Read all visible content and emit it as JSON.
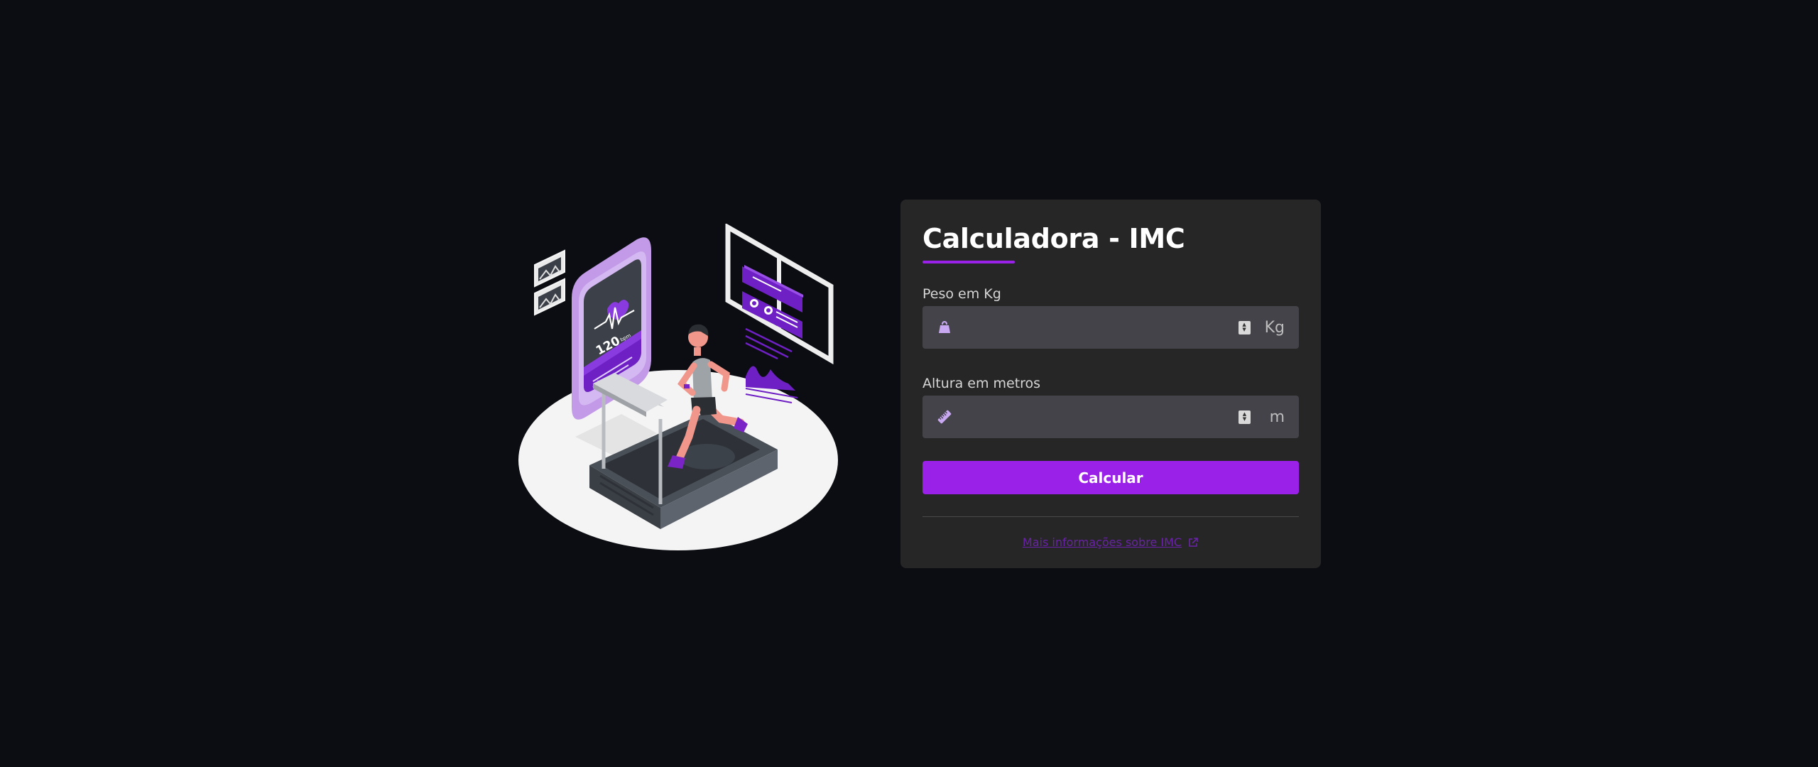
{
  "card": {
    "title": "Calculadora - IMC",
    "weight": {
      "label": "Peso em Kg",
      "value": "",
      "unit": "Kg",
      "icon": "weight-icon"
    },
    "height": {
      "label": "Altura em metros",
      "value": "",
      "unit": "m",
      "icon": "ruler-icon"
    },
    "button_label": "Calcular",
    "more_link": "Mais informações sobre IMC",
    "more_link_icon": "external-link-icon"
  },
  "illustration": {
    "bpm": "120",
    "bpm_unit": "bpm"
  },
  "colors": {
    "background": "#0b0d13",
    "card": "#262626",
    "input": "#434349",
    "accent": "#9a22e8",
    "illustration_purple": "#6f20c4",
    "illustration_lavender": "#c8a8f0"
  }
}
